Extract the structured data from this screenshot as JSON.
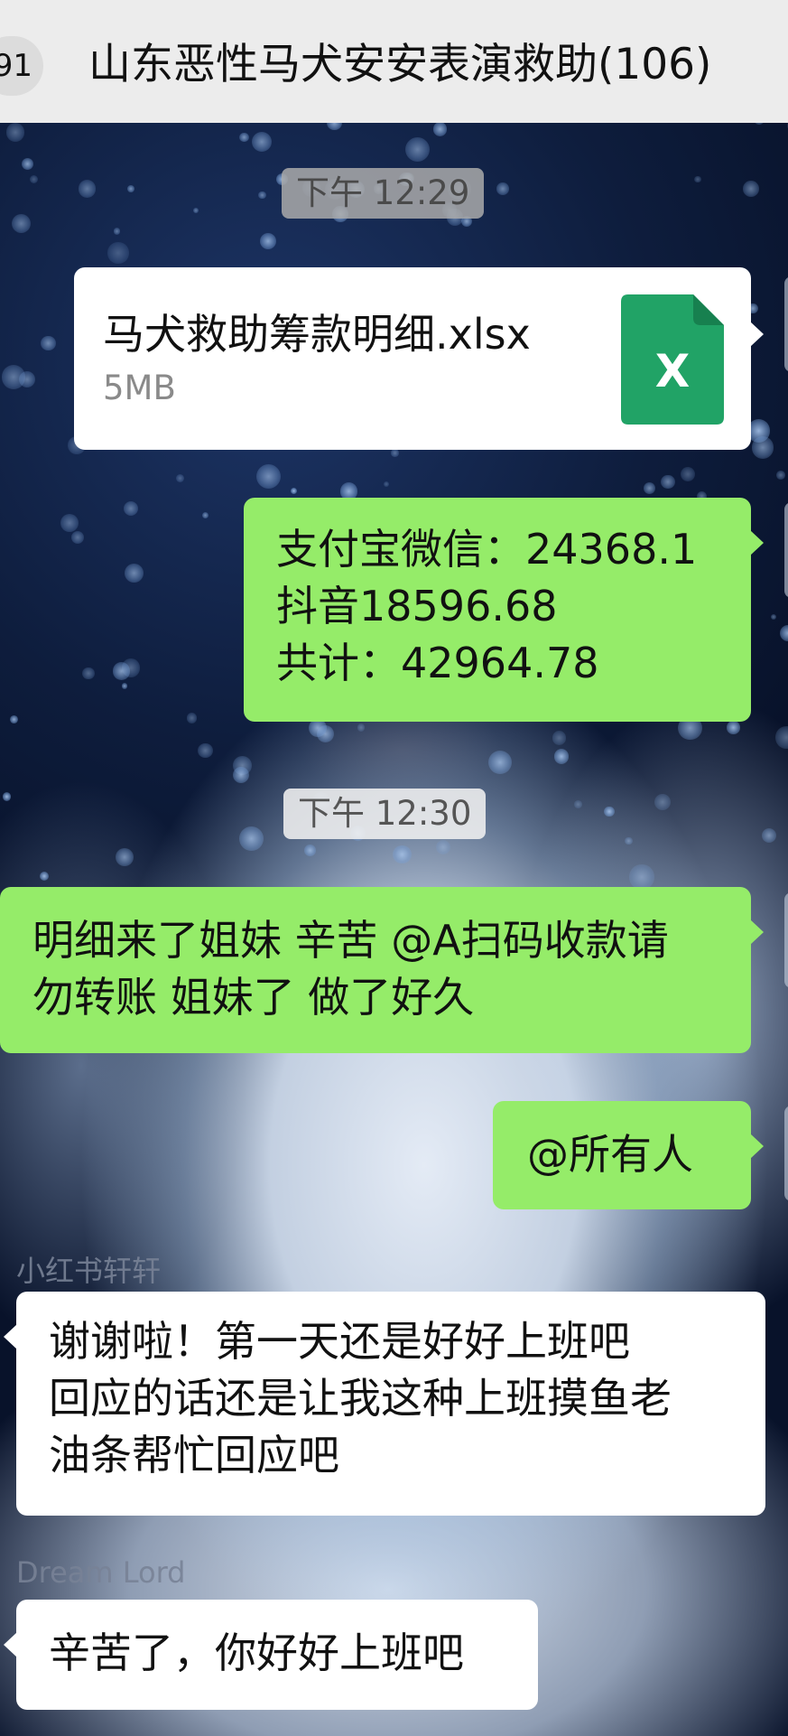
{
  "header": {
    "back_count": "91",
    "title": "山东恶性马犬安安表演救助(106)"
  },
  "messages": [
    {
      "type": "time",
      "text": "下午 12:29"
    },
    {
      "type": "file",
      "file_name": "马犬救助筹款明细.xlsx",
      "file_size": "5MB",
      "icon_label": "X",
      "icon": "excel-file-icon",
      "icon_color": "#21a366"
    },
    {
      "type": "text",
      "side": "right",
      "text": "支付宝微信：24368.1\n抖音18596.68\n共计：42964.78"
    },
    {
      "type": "time",
      "text": "下午 12:30"
    },
    {
      "type": "text",
      "side": "right",
      "text": "明细来了姐妹 辛苦 @A扫码收款请\n勿转账 姐妹了 做了好久"
    },
    {
      "type": "text",
      "side": "right",
      "text": "@所有人"
    },
    {
      "type": "text",
      "side": "left",
      "sender": "小红书轩轩",
      "text": "谢谢啦！第一天还是好好上班吧\n回应的话还是让我这种上班摸鱼老\n油条帮忙回应吧"
    },
    {
      "type": "text",
      "side": "left",
      "sender": "Dream Lord",
      "text": "辛苦了，你好好上班吧"
    }
  ],
  "colors": {
    "header_bg": "#ececec",
    "bubble_green": "#95ec69",
    "bubble_white": "#ffffff",
    "excel_green": "#21a366"
  }
}
